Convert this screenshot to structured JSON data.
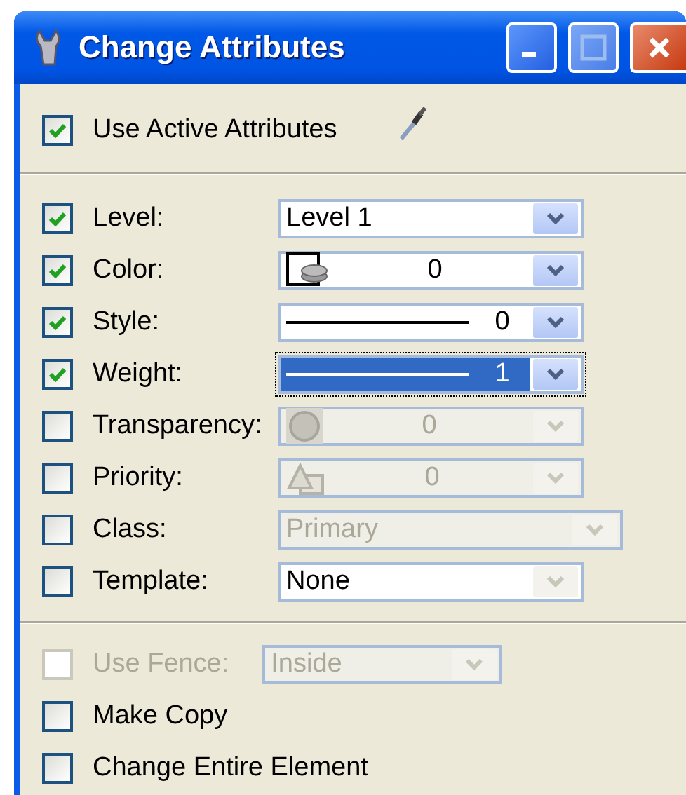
{
  "window": {
    "title": "Change Attributes"
  },
  "use_active_attributes": {
    "label": "Use Active Attributes",
    "checked": true
  },
  "attributes": [
    {
      "label": "Level:",
      "checked": true,
      "kind": "text",
      "value": "Level 1",
      "disabled": false,
      "focused": false
    },
    {
      "label": "Color:",
      "checked": true,
      "kind": "color",
      "value": "0",
      "disabled": false,
      "focused": false
    },
    {
      "label": "Style:",
      "checked": true,
      "kind": "line",
      "value": "0",
      "disabled": false,
      "focused": false
    },
    {
      "label": "Weight:",
      "checked": true,
      "kind": "line",
      "value": "1",
      "disabled": false,
      "focused": true
    },
    {
      "label": "Transparency:",
      "checked": false,
      "kind": "transparency",
      "value": "0",
      "disabled": true,
      "focused": false
    },
    {
      "label": "Priority:",
      "checked": false,
      "kind": "priority",
      "value": "0",
      "disabled": true,
      "focused": false
    },
    {
      "label": "Class:",
      "checked": false,
      "kind": "list",
      "value": "Primary",
      "disabled": true,
      "focused": false
    },
    {
      "label": "Template:",
      "checked": false,
      "kind": "text",
      "value": "None",
      "disabled": false,
      "focused": false,
      "arrow_disabled": true
    }
  ],
  "use_fence": {
    "label": "Use Fence:",
    "checked": false,
    "disabled": true,
    "value": "Inside"
  },
  "options": [
    {
      "label": "Make Copy",
      "checked": false
    },
    {
      "label": "Change Entire Element",
      "checked": false
    }
  ]
}
